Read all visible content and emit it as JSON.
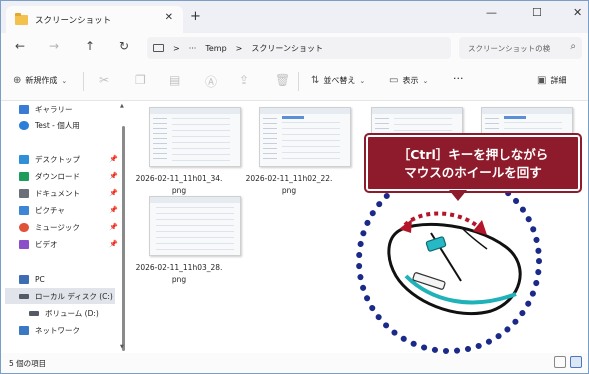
{
  "window": {
    "tab_title": "スクリーンショット",
    "tab_close": "✕",
    "new_tab": "+",
    "minimize": "—",
    "maximize": "☐",
    "close": "✕"
  },
  "address": {
    "back": "←",
    "forward": "→",
    "up": "↑",
    "refresh": "↻",
    "chevron": ">",
    "ellipsis": "···",
    "crumb_1": "Temp",
    "crumb_2": "スクリーンショット",
    "search_placeholder": "スクリーンショットの検"
  },
  "commands": {
    "new": "新規作成",
    "sort": "並べ替え",
    "view": "表示",
    "more": "···",
    "details": "詳細"
  },
  "sidebar": {
    "items": [
      {
        "label": "ギャラリー",
        "icon": "gallery-icon",
        "color": "#3a7bd5"
      },
      {
        "label": "Test - 個人用",
        "icon": "onedrive-icon",
        "color": "#2b7fd9"
      },
      {
        "label": "デスクトップ",
        "icon": "desktop-icon",
        "color": "#2f8fd8"
      },
      {
        "label": "ダウンロード",
        "icon": "download-icon",
        "color": "#1f9c5b"
      },
      {
        "label": "ドキュメント",
        "icon": "documents-icon",
        "color": "#6a6f7a"
      },
      {
        "label": "ピクチャ",
        "icon": "pictures-icon",
        "color": "#3d86d6"
      },
      {
        "label": "ミュージック",
        "icon": "music-icon",
        "color": "#e0533b"
      },
      {
        "label": "ビデオ",
        "icon": "videos-icon",
        "color": "#8b4fc9"
      },
      {
        "label": "PC",
        "icon": "pc-icon",
        "color": "#3f6db3"
      },
      {
        "label": "ローカル ディスク (C:)",
        "icon": "drive-icon",
        "color": "#555b66"
      },
      {
        "label": "ボリューム (D:)",
        "icon": "drive-icon",
        "color": "#555b66"
      },
      {
        "label": "ネットワーク",
        "icon": "network-icon",
        "color": "#3b78c4"
      }
    ]
  },
  "files": [
    {
      "name": "2026-02-11_11h01_34.png"
    },
    {
      "name": "2026-02-11_11h02_22.png"
    },
    {
      "name": "2026-02-11_11h03_28.png"
    }
  ],
  "status": {
    "count": "5 個の項目"
  },
  "callout": {
    "line1": "［Ctrl］キーを押しながら",
    "line2": "マウスのホイールを回す"
  },
  "colors": {
    "accent": "#8e1b2b",
    "dotted_circle": "#1b2a88",
    "wheel_arrow": "#b3162b",
    "mouse_accent": "#1fb2b8"
  }
}
